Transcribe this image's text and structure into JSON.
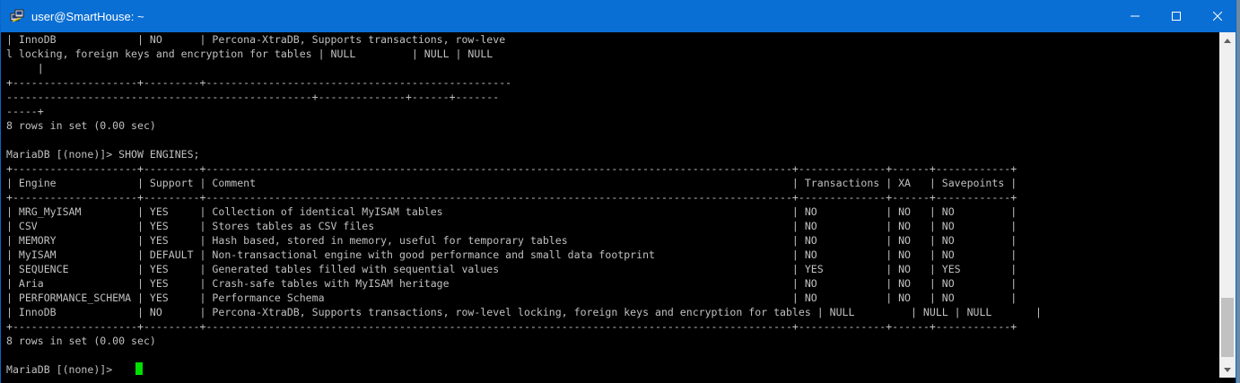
{
  "window": {
    "title": "user@SmartHouse: ~"
  },
  "title_buttons": {
    "minimize": "minimize-icon",
    "maximize": "maximize-icon",
    "close": "close-icon"
  },
  "terminal": {
    "lines": [
      "| InnoDB             | NO      | Percona-XtraDB, Supports transactions, row-leve",
      "l locking, foreign keys and encryption for tables | NULL         | NULL | NULL",
      "     |",
      "+--------------------+---------+-------------------------------------------------",
      "-------------------------------------------------+--------------+------+-------",
      "-----+",
      "8 rows in set (0.00 sec)",
      "",
      "MariaDB [(none)]> SHOW ENGINES;",
      "+--------------------+---------+----------------------------------------------------------------------------------------------+--------------+------+------------+",
      "| Engine             | Support | Comment                                                                                      | Transactions | XA   | Savepoints |",
      "+--------------------+---------+----------------------------------------------------------------------------------------------+--------------+------+------------+",
      "| MRG_MyISAM         | YES     | Collection of identical MyISAM tables                                                        | NO           | NO   | NO         |",
      "| CSV                | YES     | Stores tables as CSV files                                                                   | NO           | NO   | NO         |",
      "| MEMORY             | YES     | Hash based, stored in memory, useful for temporary tables                                    | NO           | NO   | NO         |",
      "| MyISAM             | DEFAULT | Non-transactional engine with good performance and small data footprint                      | NO           | NO   | NO         |",
      "| SEQUENCE           | YES     | Generated tables filled with sequential values                                               | YES          | NO   | YES        |",
      "| Aria               | YES     | Crash-safe tables with MyISAM heritage                                                       | NO           | NO   | NO         |",
      "| PERFORMANCE_SCHEMA | YES     | Performance Schema                                                                           | NO           | NO   | NO         |",
      "| InnoDB             | NO      | Percona-XtraDB, Supports transactions, row-level locking, foreign keys and encryption for tables | NULL         | NULL | NULL       |",
      "+--------------------+---------+----------------------------------------------------------------------------------------------+--------------+------+------------+",
      "8 rows in set (0.00 sec)",
      "",
      "MariaDB [(none)]> "
    ]
  },
  "colors": {
    "titlebar": "#0a6fd4",
    "text": "#c0c0c0",
    "cursor": "#00e000",
    "background": "#000000"
  }
}
